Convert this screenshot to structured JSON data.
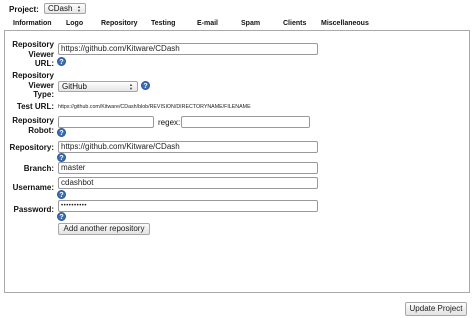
{
  "project": {
    "label": "Project:",
    "selected": "CDash"
  },
  "tabs": [
    "Information",
    "Logo",
    "Repository",
    "Testing",
    "E-mail",
    "Spam",
    "Clients",
    "Miscellaneous"
  ],
  "form": {
    "viewer_url_label": [
      "Repository",
      "Viewer",
      "URL:"
    ],
    "viewer_url_value": "https://github.com/Kitware/CDash",
    "viewer_type_label": [
      "Repository",
      "Viewer",
      "Type:"
    ],
    "viewer_type_value": "GitHub",
    "test_url_label": "Test URL:",
    "test_url_value": "https://github.com/Kitware/CDash/blob/REVISION/DIRECTORYNAME/FILENAME",
    "robot_label": [
      "Repository",
      "Robot:"
    ],
    "robot_value": "",
    "regex_label": "regex:",
    "regex_value": "",
    "repository_label": "Repository:",
    "repository_value": "https://github.com/Kitware/CDash",
    "branch_label": "Branch:",
    "branch_value": "master",
    "username_label": "Username:",
    "username_value": "cdashbot",
    "password_label": "Password:",
    "password_value": "••••••••••",
    "help_glyph": "?",
    "add_repo_label": "Add another repository"
  },
  "footer": {
    "update_label": "Update Project"
  },
  "colors": {
    "help_icon": "#3a6fb8",
    "panel_border": "#a9a9a9"
  }
}
